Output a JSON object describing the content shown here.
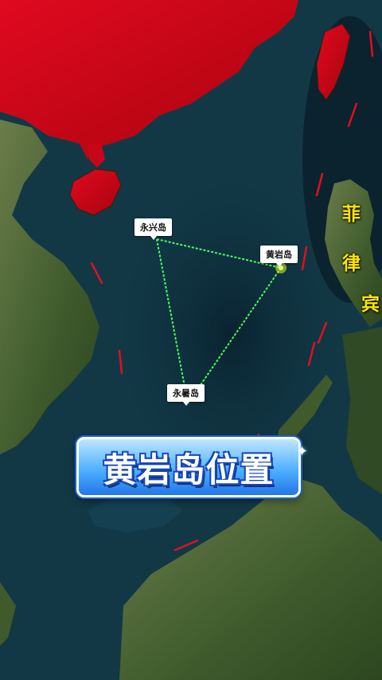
{
  "map": {
    "labels": {
      "yongxing": "永兴岛",
      "huangyan": "黄岩岛",
      "yongshu": "永暑岛"
    },
    "country_label_chars": [
      "菲",
      "律",
      "宾"
    ],
    "banner_title": "黄岩岛位置",
    "colors": {
      "china_land": "#d1061b",
      "sea": "#0e2f3a",
      "deep_sea": "#0a2230",
      "land": "#4f6b3a",
      "route_line": "#45ff5a",
      "boundary_dash": "#e01020",
      "label_text": "#ffe600",
      "banner_top": "#bfe6ff",
      "banner_bottom": "#2377e8"
    },
    "icons": [
      "location-pin",
      "sparkle-icon"
    ]
  }
}
